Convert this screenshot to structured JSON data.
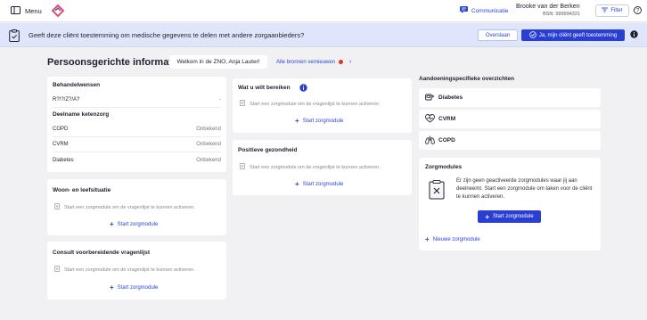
{
  "topbar": {
    "menu_label": "Menu",
    "communicatie_label": "Communicatie",
    "user_name": "Brooke van der Berken",
    "user_bsn": "BSN: 999994321",
    "filter_label": "Filter"
  },
  "banner": {
    "question": "Geeft deze cliënt toestemming om medische gegevens te delen met andere zorgaanbieders?",
    "skip_label": "Overslaan",
    "consent_label": "Ja, mijn cliënt geeft toestemming"
  },
  "header": {
    "title": "Persoonsgerichte informatie",
    "welcome": "Welkom in de ZNO, Anja Lauter!",
    "refresh_label": "Alle bronnen vernieuwen"
  },
  "behandelwensen": {
    "title": "Behandelwensen",
    "row_label": "R?!?/Z?/A?",
    "row_value": "-"
  },
  "ketenzorg": {
    "title": "Deelname ketenzorg",
    "rows": [
      {
        "label": "COPD",
        "value": "Onbekend"
      },
      {
        "label": "CVRM",
        "value": "Onbekend"
      },
      {
        "label": "Diabetes",
        "value": "Onbekend"
      }
    ]
  },
  "empty_text": "Start een zorgmodule om de vragenlijst te kunnen activeren.",
  "start_label": "Start zorgmodule",
  "woon": {
    "title": "Woon- en leefsituatie"
  },
  "consult": {
    "title": "Consult voorbereidende vragenlijst"
  },
  "bereiken": {
    "title": "Wat u wilt bereiken"
  },
  "gezondheid": {
    "title": "Positieve gezondheid"
  },
  "conditions": {
    "title": "Aandoeningspecifieke overzichten",
    "items": [
      {
        "label": "Diabetes",
        "icon": "diabetes-icon"
      },
      {
        "label": "CVRM",
        "icon": "heart-icon"
      },
      {
        "label": "COPD",
        "icon": "lungs-icon"
      }
    ]
  },
  "zorgmodules": {
    "title": "Zorgmodules",
    "message": "Er zijn geen geactiveerde zorgmodules waar jij aan deelneemt. Start een zorgmodule om taken voor de cliënt te kunnen activeren.",
    "start_label": "Start zorgmodule",
    "new_label": "Nieuwe zorgmodule"
  },
  "colors": {
    "accent": "#2a3fd1",
    "link": "#2a46d4",
    "banner_bg": "#dfe6fb",
    "background": "#f1f1f3",
    "alert": "#d9362b"
  }
}
